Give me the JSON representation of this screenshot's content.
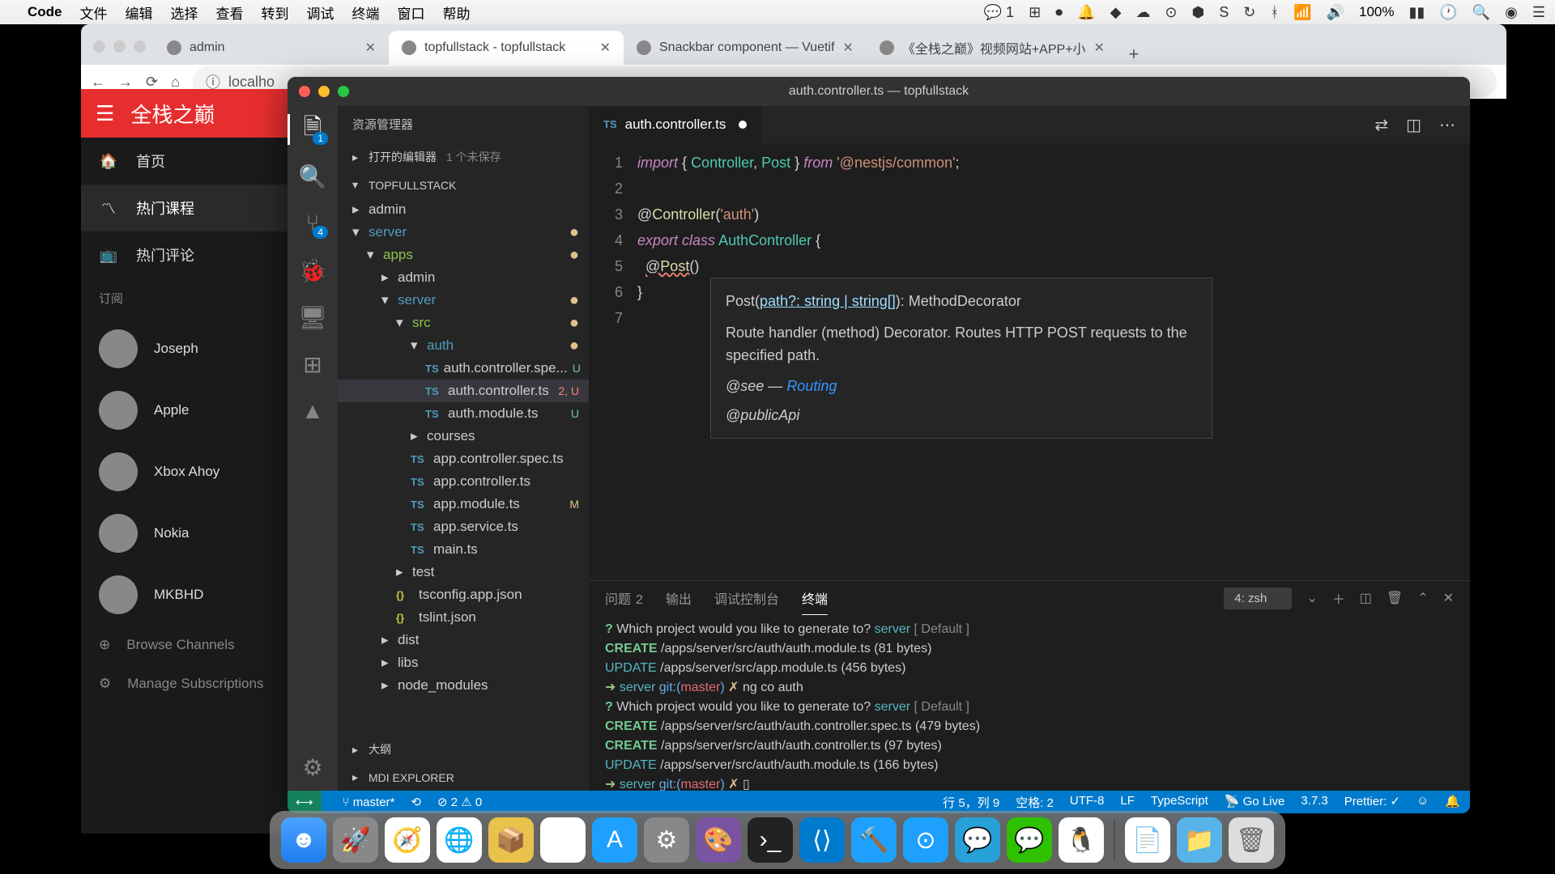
{
  "menubar": {
    "app": "Code",
    "items": [
      "文件",
      "编辑",
      "选择",
      "查看",
      "转到",
      "调试",
      "终端",
      "窗口",
      "帮助"
    ],
    "right": {
      "count": "1",
      "battery": "100%",
      "batteryIcon": "🔋"
    }
  },
  "browser": {
    "tabs": [
      {
        "label": "admin",
        "active": false
      },
      {
        "label": "topfullstack - topfullstack",
        "active": true
      },
      {
        "label": "Snackbar component — Vuetif",
        "active": false
      },
      {
        "label": "《全栈之巅》视频网站+APP+小",
        "active": false
      }
    ],
    "url": "localho"
  },
  "webapp": {
    "title": "全栈之巅",
    "nav": [
      {
        "icon": "🏠",
        "label": "首页"
      },
      {
        "icon": "〽",
        "label": "热门课程",
        "active": true
      },
      {
        "icon": "📺",
        "label": "热门评论"
      }
    ],
    "subscribe": "订阅",
    "users": [
      {
        "name": "Joseph"
      },
      {
        "name": "Apple"
      },
      {
        "name": "Xbox Ahoy"
      },
      {
        "name": "Nokia"
      },
      {
        "name": "MKBHD"
      }
    ],
    "manage": [
      {
        "icon": "⊕",
        "label": "Browse Channels"
      },
      {
        "icon": "⚙",
        "label": "Manage Subscriptions"
      }
    ]
  },
  "vscode": {
    "title": "auth.controller.ts — topfullstack",
    "explorer": {
      "title": "资源管理器",
      "openEditors": "打开的编辑器",
      "unsaved": "1 个未保存",
      "root": "TOPFULLSTACK",
      "outline": "大纲",
      "mdi": "MDI EXPLORER"
    },
    "tree": [
      {
        "depth": 0,
        "chev": "▸",
        "name": "admin",
        "type": "folder"
      },
      {
        "depth": 0,
        "chev": "▾",
        "name": "server",
        "type": "folder",
        "cls": "blue",
        "dot": true
      },
      {
        "depth": 1,
        "chev": "▾",
        "name": "apps",
        "type": "folder",
        "cls": "green",
        "dot": true
      },
      {
        "depth": 2,
        "chev": "▸",
        "name": "admin",
        "type": "folder"
      },
      {
        "depth": 2,
        "chev": "▾",
        "name": "server",
        "type": "folder",
        "cls": "blue",
        "dot": true
      },
      {
        "depth": 3,
        "chev": "▾",
        "name": "src",
        "type": "folder",
        "cls": "green",
        "dot": true
      },
      {
        "depth": 4,
        "chev": "▾",
        "name": "auth",
        "type": "folder",
        "cls": "blue",
        "dot": true
      },
      {
        "depth": 5,
        "icon": "TS",
        "name": "auth.controller.spe...",
        "status": "U",
        "statusCls": "git-u"
      },
      {
        "depth": 5,
        "icon": "TS",
        "name": "auth.controller.ts",
        "status": "2, U",
        "statusCls": "git-err",
        "selected": true,
        "activeFile": true
      },
      {
        "depth": 5,
        "icon": "TS",
        "name": "auth.module.ts",
        "status": "U",
        "statusCls": "git-u"
      },
      {
        "depth": 4,
        "chev": "▸",
        "name": "courses",
        "type": "folder"
      },
      {
        "depth": 4,
        "icon": "TS",
        "name": "app.controller.spec.ts"
      },
      {
        "depth": 4,
        "icon": "TS",
        "name": "app.controller.ts"
      },
      {
        "depth": 4,
        "icon": "TS",
        "name": "app.module.ts",
        "status": "M",
        "statusCls": "git-m"
      },
      {
        "depth": 4,
        "icon": "TS",
        "name": "app.service.ts"
      },
      {
        "depth": 4,
        "icon": "TS",
        "name": "main.ts"
      },
      {
        "depth": 3,
        "chev": "▸",
        "name": "test",
        "type": "folder"
      },
      {
        "depth": 3,
        "icon": "{}",
        "iconCls": "json",
        "name": "tsconfig.app.json"
      },
      {
        "depth": 3,
        "icon": "{}",
        "iconCls": "json",
        "name": "tslint.json"
      },
      {
        "depth": 2,
        "chev": "▸",
        "name": "dist",
        "type": "folder",
        "dim": true
      },
      {
        "depth": 2,
        "chev": "▸",
        "name": "libs",
        "type": "folder"
      },
      {
        "depth": 2,
        "chev": "▸",
        "name": "node_modules",
        "type": "folder",
        "dim": true
      }
    ],
    "editorTab": {
      "icon": "TS",
      "name": "auth.controller.ts"
    },
    "code": {
      "lines": [
        1,
        2,
        3,
        4,
        5,
        6,
        7
      ]
    },
    "signature": {
      "sig": "Post(path?: string | string[]): MethodDecorator",
      "desc": "Route handler (method) Decorator. Routes HTTP POST requests to the specified path.",
      "see": "@see",
      "dash": " — ",
      "link": "Routing",
      "api": "@publicApi"
    },
    "panel": {
      "tabs": {
        "problems": "问题",
        "problemsCount": "2",
        "output": "输出",
        "debug": "调试控制台",
        "terminal": "终端"
      },
      "terminalName": "4: zsh",
      "lines": [
        {
          "segs": [
            {
              "t": "? ",
              "c": "t-green"
            },
            {
              "t": "Which project would you like to generate to? ",
              "c": ""
            },
            {
              "t": "server",
              "c": "t-cyan"
            },
            {
              "t": " [ Default ]",
              "c": "t-gray"
            }
          ]
        },
        {
          "segs": [
            {
              "t": "CREATE ",
              "c": "t-green"
            },
            {
              "t": "/apps/server/src/auth/auth.module.ts (81 bytes)",
              "c": ""
            }
          ]
        },
        {
          "segs": [
            {
              "t": "UPDATE ",
              "c": "t-cyan"
            },
            {
              "t": "/apps/server/src/app.module.ts (456 bytes)",
              "c": ""
            }
          ]
        },
        {
          "segs": [
            {
              "t": "➜  ",
              "c": "t-prompt"
            },
            {
              "t": "server ",
              "c": "t-cyan"
            },
            {
              "t": "git:(",
              "c": "t-blue"
            },
            {
              "t": "master",
              "c": "t-red"
            },
            {
              "t": ") ",
              "c": "t-blue"
            },
            {
              "t": "✗ ",
              "c": "t-yellow"
            },
            {
              "t": "ng co auth",
              "c": ""
            }
          ]
        },
        {
          "segs": [
            {
              "t": "? ",
              "c": "t-green"
            },
            {
              "t": "Which project would you like to generate to? ",
              "c": ""
            },
            {
              "t": "server",
              "c": "t-cyan"
            },
            {
              "t": " [ Default ]",
              "c": "t-gray"
            }
          ]
        },
        {
          "segs": [
            {
              "t": "CREATE ",
              "c": "t-green"
            },
            {
              "t": "/apps/server/src/auth/auth.controller.spec.ts (479 bytes)",
              "c": ""
            }
          ]
        },
        {
          "segs": [
            {
              "t": "CREATE ",
              "c": "t-green"
            },
            {
              "t": "/apps/server/src/auth/auth.controller.ts (97 bytes)",
              "c": ""
            }
          ]
        },
        {
          "segs": [
            {
              "t": "UPDATE ",
              "c": "t-cyan"
            },
            {
              "t": "/apps/server/src/auth/auth.module.ts (166 bytes)",
              "c": ""
            }
          ]
        },
        {
          "segs": [
            {
              "t": "➜  ",
              "c": "t-prompt"
            },
            {
              "t": "server ",
              "c": "t-cyan"
            },
            {
              "t": "git:(",
              "c": "t-blue"
            },
            {
              "t": "master",
              "c": "t-red"
            },
            {
              "t": ") ",
              "c": "t-blue"
            },
            {
              "t": "✗ ",
              "c": "t-yellow"
            },
            {
              "t": "▯",
              "c": ""
            }
          ]
        }
      ]
    },
    "status": {
      "branch": "master*",
      "errors": "2",
      "warnings": "0",
      "cursor": "行 5，列 9",
      "spaces": "空格: 2",
      "encoding": "UTF-8",
      "eol": "LF",
      "lang": "TypeScript",
      "golive": "Go Live",
      "version": "3.7.3",
      "prettier": "Prettier: ✓"
    }
  }
}
